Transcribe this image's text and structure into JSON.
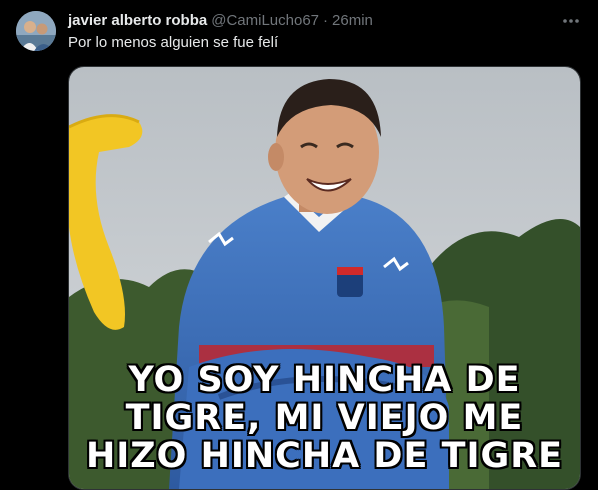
{
  "tweet": {
    "display_name": "javier alberto robba",
    "handle": "@CamiLucho67",
    "separator": "·",
    "time": "26min",
    "text": "Por lo menos alguien se fue felí"
  },
  "media": {
    "caption_lines": [
      "YO SOY HINCHA DE",
      "TIGRE, MI VIEJO ME",
      "HIZO HINCHA DE TIGRE"
    ]
  },
  "icons": {
    "more": "more-horizontal-icon"
  },
  "colors": {
    "background": "#000000",
    "text_primary": "#e7e9ea",
    "text_secondary": "#71767b",
    "border": "#2f3336"
  }
}
